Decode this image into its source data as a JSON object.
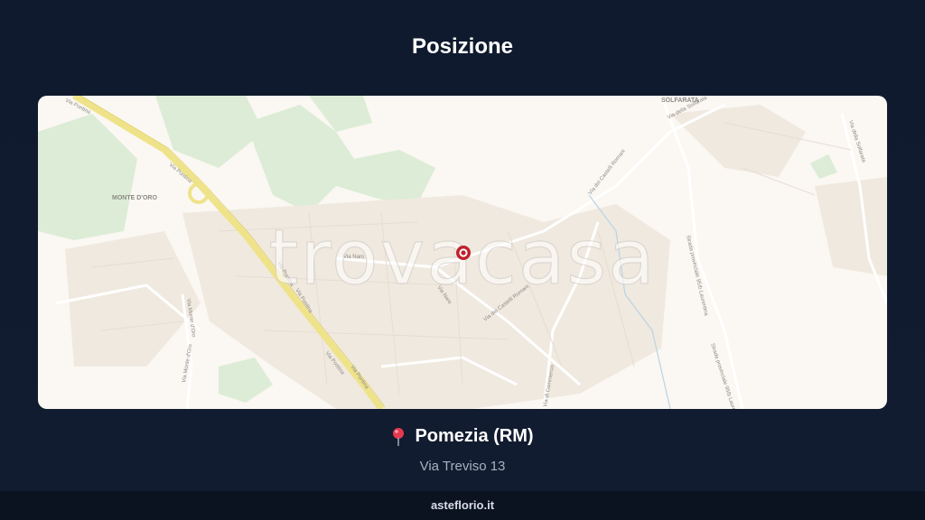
{
  "page": {
    "title": "Posizione"
  },
  "map": {
    "watermark": "trovacasa",
    "places": {
      "monte_doro": "MONTE D'ORO",
      "solfarata": "SOLFARATA"
    },
    "streets": {
      "via_pontina_1": "Via Pontina",
      "via_pontina_2": "Via Pontina",
      "via_pontina_3": "Via Pontina",
      "via_pontina_4": "Via Pontina",
      "via_pontina_5": "Via Pontina",
      "via_pontina_6": "Via Pontina",
      "via_naro_1": "Via Naro",
      "via_naro_2": "Via Naro",
      "via_castelli_1": "Via dei Castelli Romani",
      "via_castelli_2": "Via dei Castelli Romani",
      "via_monte_doro_1": "Via Monte d'Oro",
      "via_monte_doro_2": "Via Monte d'Oro",
      "via_commercio": "Via di Commercio",
      "via_solfarata": "Via della Solfarata",
      "via_solfarata_2": "Via della Solfarata",
      "sp_laurentina_1": "Strada provinciale 95/b Laurentina",
      "sp_laurentina_2": "Strada provinciale 95/b Laurentina"
    },
    "marker_icon": "map-pin-icon",
    "colors": {
      "marker": "#c0202b",
      "green": "#d7ead3",
      "road_major": "#efe38a"
    }
  },
  "location": {
    "pin_icon": "pushpin-icon",
    "city": "Pomezia (RM)",
    "street": "Via Treviso 13"
  },
  "footer": {
    "brand": "asteflorio.it"
  }
}
